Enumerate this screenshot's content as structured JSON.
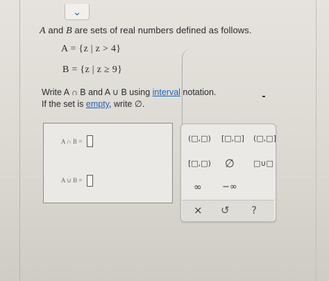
{
  "nav": {
    "collapse_icon": "chevron-down-icon",
    "collapse_glyph": "⌄"
  },
  "problem": {
    "intro_a": "A",
    "intro_mid": " and ",
    "intro_b": "B",
    "intro_rest": " are sets of real numbers defined as follows.",
    "set_a": "A = {z | z > 4}",
    "set_b": "B = {z | z ≥ 9}",
    "instruction_pre": "Write A ∩ B and A ∪ B using ",
    "instruction_link": "interval",
    "instruction_post": " notation.",
    "empty_pre": "If the set is ",
    "empty_link": "empty",
    "empty_post": ", write ∅."
  },
  "answers": {
    "intersection_label": "A ∩ B =",
    "intersection_value": "",
    "union_label": "A ∪ B =",
    "union_value": ""
  },
  "palette": {
    "open_open": "(□,□)",
    "closed_closed": "[□,□]",
    "open_closed": "(□,□]",
    "closed_open": "[□,□)",
    "empty_set": "∅",
    "union": "□∪□",
    "infinity": "∞",
    "neg_infinity": "−∞",
    "clear": "×",
    "undo": "↺",
    "help": "?"
  }
}
